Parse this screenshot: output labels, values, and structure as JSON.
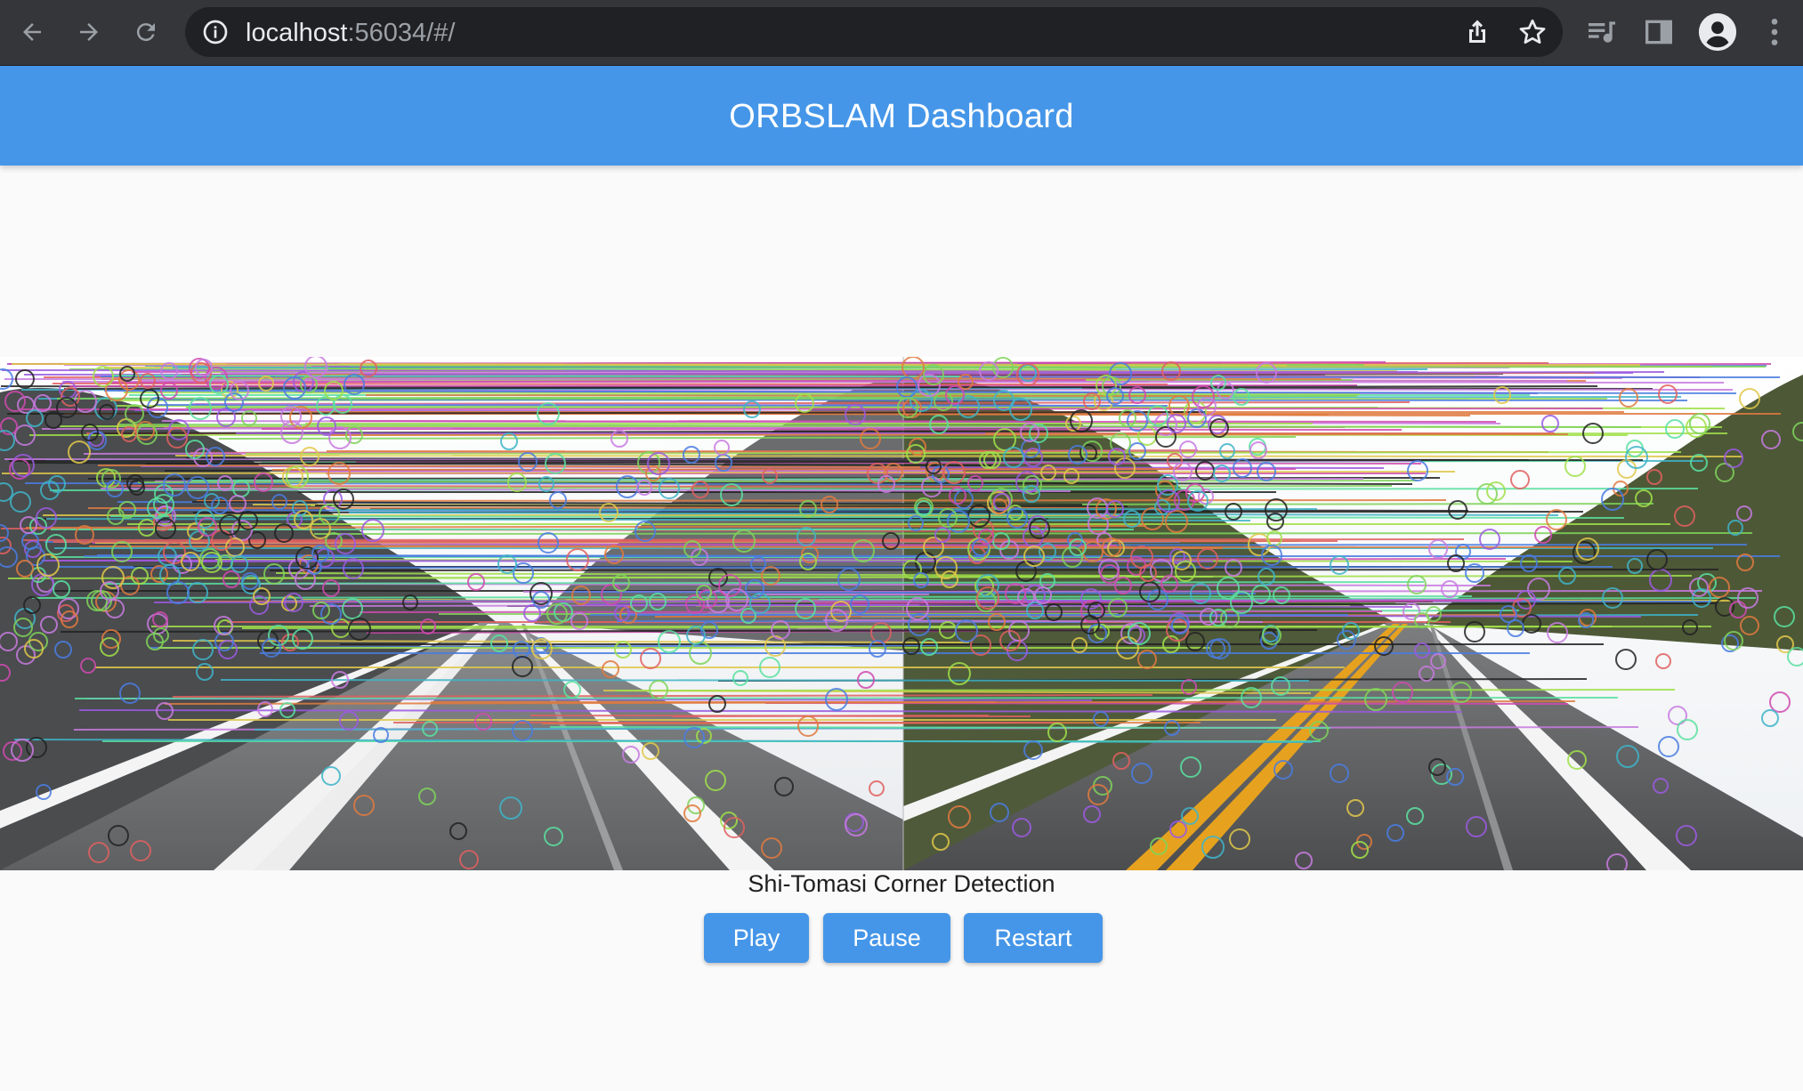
{
  "browser": {
    "url_host": "localhost",
    "url_rest": ":56034/#/",
    "icons": {
      "back": "back-arrow-icon",
      "forward": "forward-arrow-icon",
      "reload": "reload-icon",
      "site_info": "info-icon",
      "share": "share-icon",
      "bookmark": "star-icon",
      "media": "media-queue-icon",
      "side_panel": "side-panel-icon",
      "profile": "profile-icon",
      "menu": "kebab-menu-icon"
    }
  },
  "app": {
    "title": "ORBSLAM Dashboard",
    "accent_color": "#4596e8"
  },
  "viewer": {
    "caption": "Shi-Tomasi Corner Detection"
  },
  "controls": {
    "play_label": "Play",
    "pause_label": "Pause",
    "restart_label": "Restart"
  }
}
